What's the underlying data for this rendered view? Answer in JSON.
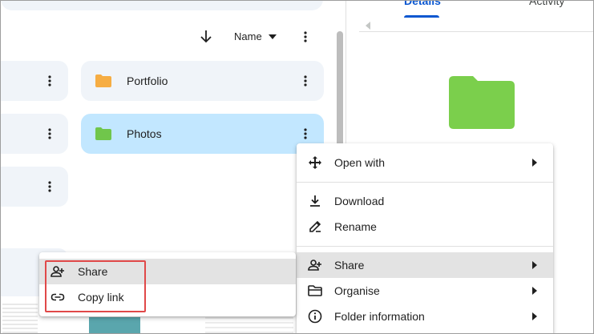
{
  "toolbar": {
    "sort_label": "Name",
    "sort_direction_icon": "arrow-down-icon",
    "more_icon": "more-vert-icon"
  },
  "folders": [
    {
      "name": "Portfolio",
      "color": "#f6ad43",
      "selected": false
    },
    {
      "name": "Photos",
      "color": "#70c64b",
      "selected": true
    }
  ],
  "details_panel": {
    "tabs": [
      {
        "label": "Details",
        "active": true
      },
      {
        "label": "Activity",
        "active": false
      }
    ],
    "folder_color": "#7bcf4c"
  },
  "context_menu": {
    "items": [
      {
        "label": "Open with",
        "icon": "move-arrows-icon",
        "submenu": true
      },
      {
        "label": "Download",
        "icon": "download-icon",
        "submenu": false
      },
      {
        "label": "Rename",
        "icon": "pencil-icon",
        "submenu": false
      },
      {
        "label": "Share",
        "icon": "person-add-icon",
        "submenu": true,
        "hovered": true
      },
      {
        "label": "Organise",
        "icon": "folder-open-icon",
        "submenu": true
      },
      {
        "label": "Folder information",
        "icon": "info-icon",
        "submenu": true
      }
    ]
  },
  "share_submenu": {
    "items": [
      {
        "label": "Share",
        "icon": "person-add-icon",
        "hovered": true
      },
      {
        "label": "Copy link",
        "icon": "link-icon",
        "hovered": false
      }
    ],
    "highlight_color": "#e04848"
  },
  "colors": {
    "accent": "#0b57d0",
    "card_bg": "#f0f4f9",
    "selected_bg": "#c2e7ff",
    "menu_hover": "#e3e3e3"
  }
}
